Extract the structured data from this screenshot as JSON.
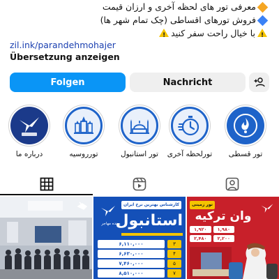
{
  "bio": {
    "line1": "معرفی تور های لحظه آخری و ارزان قیمت",
    "line2": "فروش تورهای اقساطی (چک تمام شهر ها)",
    "line3": "با خیال راحت سفر کنید",
    "link": "zil.ink/parandehmohajer",
    "translate": "Übersetzung anzeigen"
  },
  "actions": {
    "follow": "Folgen",
    "message": "Nachricht"
  },
  "highlights": [
    {
      "label": "تور قسطی",
      "icon": "tour-installment-icon"
    },
    {
      "label": "تورلحظه آخری",
      "icon": "last-minute-stopwatch-icon"
    },
    {
      "label": "تور استانبول",
      "icon": "istanbul-mosque-icon"
    },
    {
      "label": "تورروسیه",
      "icon": "russia-kremlin-icon"
    },
    {
      "label": "درباره ما",
      "icon": "brand-logo-icon"
    }
  ],
  "tabs": [
    "grid-icon",
    "reels-icon",
    "tagged-icon"
  ],
  "posts": {
    "post2": {
      "header": "کارشناس بهترین نرخ ایران",
      "city": "استانبول",
      "brand": "پرنده مهاجر",
      "rows": [
        "۶,۱۱۰,۰۰۰",
        "۶,۶۳۰,۰۰۰",
        "۷,۴۶۰,۰۰۰",
        "۸,۵۱۰,۰۰۰"
      ],
      "nights": [
        "۳",
        "۴",
        "۵",
        "۷"
      ]
    },
    "post3": {
      "tag": "تور زمینی",
      "title": "وان ترکیه",
      "prices": [
        "۱,۹۲۰",
        "۱,۹۸۰",
        "۲,۴۸۰",
        "۲,۲۰۰"
      ]
    }
  },
  "colors": {
    "accent": "#0a95f6",
    "brand": "#1b3a8a",
    "red": "#c8202a"
  }
}
